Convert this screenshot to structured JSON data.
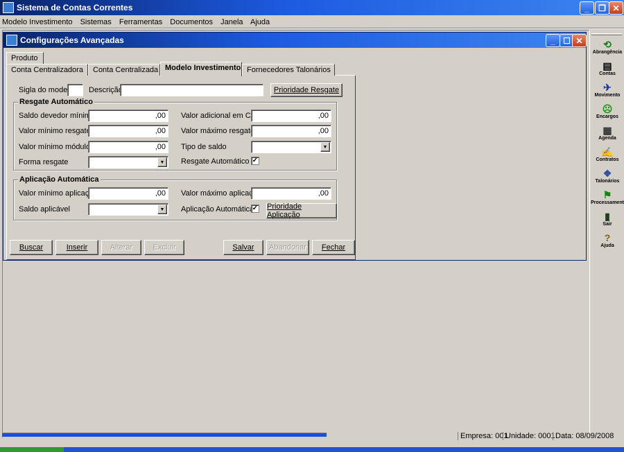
{
  "app": {
    "title": "Sistema de Contas Correntes",
    "menu": [
      "Modelo Investimento",
      "Sistemas",
      "Ferramentas",
      "Documentos",
      "Janela",
      "Ajuda"
    ]
  },
  "child_window": {
    "title": "Configurações Avançadas"
  },
  "tabs": {
    "row1": [
      "Produto"
    ],
    "row2": [
      "Conta Centralizadora",
      "Conta Centralizada",
      "Modelo Investimento",
      "Fornecedores Talonários"
    ],
    "active": "Modelo Investimento"
  },
  "form": {
    "sigla_label": "Sigla do modelo",
    "sigla_value": "",
    "descricao_label": "Descrição",
    "descricao_value": "",
    "prioridade_resgate_button": "Prioridade Resgate",
    "resgate": {
      "title": "Resgate Automático",
      "saldo_devedor_label": "Saldo devedor mínimo",
      "saldo_devedor_value": ",00",
      "valor_min_resgate_label": "Valor mínimo resgate",
      "valor_min_resgate_value": ",00",
      "valor_min_modulo_label": "Valor mínimo módulo",
      "valor_min_modulo_value": ",00",
      "forma_resgate_label": "Forma resgate",
      "forma_resgate_value": "",
      "valor_adicional_label": "Valor adicional em C/C",
      "valor_adicional_value": ",00",
      "valor_max_resgate_label": "Valor máximo resgate",
      "valor_max_resgate_value": ",00",
      "tipo_saldo_label": "Tipo de saldo",
      "tipo_saldo_value": "",
      "resgate_auto_label": "Resgate Automático",
      "resgate_auto_checked": "✓"
    },
    "aplicacao": {
      "title": "Aplicação Automática",
      "valor_min_aplicacao_label": "Valor mínimo aplicação",
      "valor_min_aplicacao_value": ",00",
      "saldo_aplicavel_label": "Saldo aplicável",
      "saldo_aplicavel_value": "",
      "valor_max_aplicacao_label": "Valor máximo aplicação",
      "valor_max_aplicacao_value": ",00",
      "aplicacao_auto_label": "Aplicação Automática",
      "aplicacao_auto_checked": "✓",
      "prioridade_aplicacao_button": "Prioridade Aplicação"
    }
  },
  "buttons": {
    "buscar": "Buscar",
    "inserir": "Inserir",
    "alterar": "Alterar",
    "excluir": "Excluir",
    "salvar": "Salvar",
    "abandonar": "Abandonar",
    "fechar": "Fechar"
  },
  "sidebar": [
    {
      "label": "Abrangência",
      "icon": "globe-icon",
      "glyph": "⟲"
    },
    {
      "label": "Contas",
      "icon": "accounts-icon",
      "glyph": "▤"
    },
    {
      "label": "Movimento",
      "icon": "runner-icon",
      "glyph": "✈"
    },
    {
      "label": "Encargos",
      "icon": "smiley-icon",
      "glyph": "☹"
    },
    {
      "label": "Agenda",
      "icon": "calendar-icon",
      "glyph": "▦"
    },
    {
      "label": "Contratos",
      "icon": "handshake-icon",
      "glyph": "✍"
    },
    {
      "label": "Talonários",
      "icon": "checkbook-icon",
      "glyph": "❖"
    },
    {
      "label": "Processament",
      "icon": "flag-icon",
      "glyph": "⚑"
    },
    {
      "label": "Sair",
      "icon": "exit-door-icon",
      "glyph": "▮"
    },
    {
      "label": "Ajuda",
      "icon": "help-icon",
      "glyph": "?"
    }
  ],
  "status": {
    "empresa": "Empresa: 001",
    "unidade": "Unidade: 0001",
    "data": "Data:  08/09/2008"
  }
}
